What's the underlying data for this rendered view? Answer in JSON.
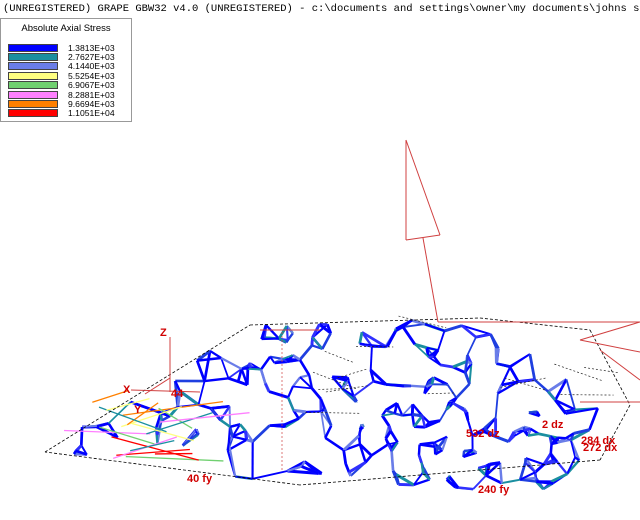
{
  "window": {
    "title": "(UNREGISTERED) GRAPE GBW32 v4.0 (UNREGISTERED)  - c:\\documents and settings\\owner\\my documents\\johns stuff\\914 base model - (S"
  },
  "legend": {
    "title": "Absolute Axial Stress",
    "entries": [
      {
        "color": "#0000ff",
        "label": "1.3813E+03"
      },
      {
        "color": "#1a8fa0",
        "label": "2.7627E+03"
      },
      {
        "color": "#6a7de8",
        "label": "4.1440E+03"
      },
      {
        "color": "#ffff80",
        "label": "5.5254E+03"
      },
      {
        "color": "#70d070",
        "label": "6.9067E+03"
      },
      {
        "color": "#ff80ff",
        "label": "8.2881E+03"
      },
      {
        "color": "#ff8000",
        "label": "9.6694E+03"
      },
      {
        "color": "#ff0000",
        "label": "1.1051E+04"
      }
    ]
  },
  "model": {
    "axes": {
      "z": "Z",
      "x": "X",
      "y": "Y"
    },
    "load_labels": [
      "44",
      "532 dz",
      "2 dz",
      "284 dx",
      "272 dx",
      "40 fy",
      "240 fy"
    ]
  },
  "colors": {
    "load": "#ff0000",
    "frame": "#000000",
    "arrow": "#d04040"
  }
}
